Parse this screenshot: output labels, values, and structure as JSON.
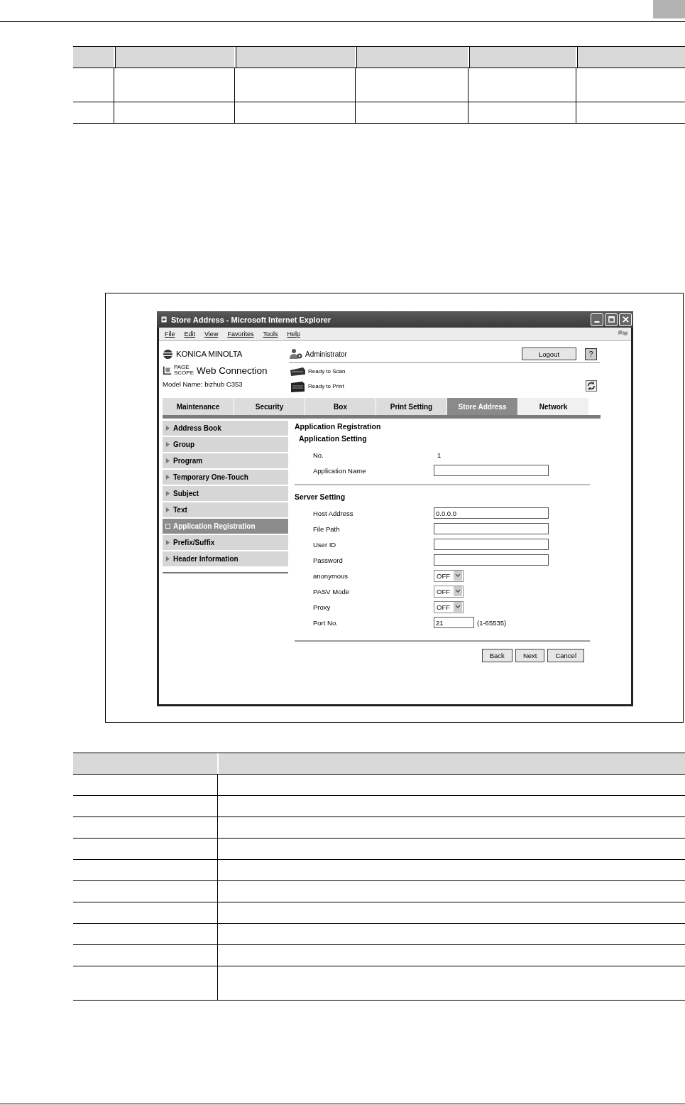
{
  "window": {
    "title": "Store Address - Microsoft Internet Explorer"
  },
  "menu": [
    "File",
    "Edit",
    "View",
    "Favorites",
    "Tools",
    "Help"
  ],
  "header": {
    "brand": "KONICA MINOLTA",
    "product_mark": "PAGE SCOPE",
    "product": "Web Connection",
    "model": "Model Name: bizhub C353",
    "user": "Administrator",
    "logout": "Logout",
    "help": "?",
    "status": [
      {
        "kind": "scanner",
        "text": "Ready to Scan"
      },
      {
        "kind": "printer",
        "text": "Ready to Print"
      }
    ]
  },
  "tabs": [
    {
      "label": "Maintenance",
      "selected": false
    },
    {
      "label": "Security",
      "selected": false
    },
    {
      "label": "Box",
      "selected": false
    },
    {
      "label": "Print Setting",
      "selected": false
    },
    {
      "label": "Store Address",
      "selected": true
    },
    {
      "label": "Network",
      "selected": false
    }
  ],
  "sidebar": [
    {
      "label": "Address Book",
      "selected": false
    },
    {
      "label": "Group",
      "selected": false
    },
    {
      "label": "Program",
      "selected": false
    },
    {
      "label": "Temporary One-Touch",
      "selected": false
    },
    {
      "label": "Subject",
      "selected": false
    },
    {
      "label": "Text",
      "selected": false
    },
    {
      "label": "Application Registration",
      "selected": true
    },
    {
      "label": "Prefix/Suffix",
      "selected": false
    },
    {
      "label": "Header Information",
      "selected": false
    }
  ],
  "form": {
    "title": "Application Registration",
    "sections": [
      {
        "title": "Application Setting",
        "fields": [
          {
            "kind": "text",
            "label": "No.",
            "value": "1"
          },
          {
            "kind": "input",
            "label": "Application Name"
          }
        ]
      },
      {
        "title": "Server Setting",
        "fields": [
          {
            "kind": "input",
            "label": "Host Address",
            "value": "0.0.0.0"
          },
          {
            "kind": "input",
            "label": "File Path"
          },
          {
            "kind": "input",
            "label": "User ID"
          },
          {
            "kind": "input",
            "label": "Password"
          },
          {
            "kind": "select",
            "label": "anonymous",
            "value": "OFF"
          },
          {
            "kind": "select",
            "label": "PASV Mode",
            "value": "OFF"
          },
          {
            "kind": "select",
            "label": "Proxy",
            "value": "OFF"
          },
          {
            "kind": "short",
            "label": "Port No.",
            "value": "21",
            "hint": "(1-65535)"
          }
        ]
      }
    ]
  },
  "buttons": [
    "Back",
    "Next",
    "Cancel"
  ]
}
